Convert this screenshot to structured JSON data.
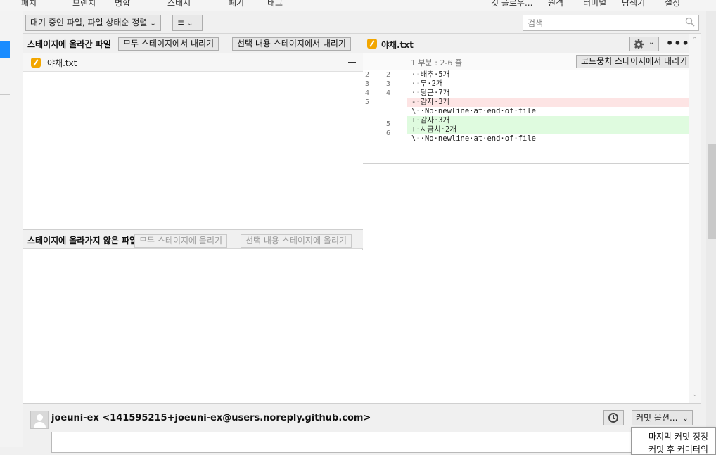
{
  "top_toolbar": {
    "labels": [
      "패치",
      "브랜치",
      "병합",
      "스태시",
      "폐기",
      "태그",
      "깃 플로우...",
      "원격",
      "터미널",
      "탐색기",
      "설정"
    ]
  },
  "filter_bar": {
    "sort_dropdown": "대기 중인 파일, 파일 상태순 정렬",
    "view_dropdown_icon": "list-icon",
    "search_placeholder": "검색"
  },
  "staged": {
    "title": "스테이지에 올라간 파일",
    "unstage_all_btn": "모두 스테이지에서 내리기",
    "unstage_selected_btn": "선택 내용 스테이지에서 내리기",
    "files": [
      {
        "name": "야채.txt",
        "status_icon": "modified-icon"
      }
    ]
  },
  "unstaged": {
    "title": "스테이지에 올라가지 않은 파일",
    "stage_all_btn": "모두 스테이지에 올리기",
    "stage_selected_btn": "선택 내용 스테이지에 올리기"
  },
  "diff": {
    "file_name": "야채.txt",
    "hunk_label": "1 부분 : 2-6 줄",
    "unstage_hunk_btn": "코드뭉치 스테이지에서 내리기",
    "lines": [
      {
        "old": "2",
        "new": "2",
        "type": "ctx",
        "text": "··배추·5개"
      },
      {
        "old": "3",
        "new": "3",
        "type": "ctx",
        "text": "··무·2개"
      },
      {
        "old": "4",
        "new": "4",
        "type": "ctx",
        "text": "··당근·7개"
      },
      {
        "old": "5",
        "new": "",
        "type": "del",
        "text": "-·감자·3개"
      },
      {
        "old": "",
        "new": "",
        "type": "ctx",
        "text": "\\··No·newline·at·end·of·file"
      },
      {
        "old": "",
        "new": "5",
        "type": "add",
        "text": "+·감자·3개"
      },
      {
        "old": "",
        "new": "6",
        "type": "add",
        "text": "+·시금치·2개"
      },
      {
        "old": "",
        "new": "",
        "type": "ctx",
        "text": "\\··No·newline·at·end·of·file"
      }
    ]
  },
  "commit": {
    "author": "joeuni-ex <141595215+joeuni-ex@users.noreply.github.com>",
    "options_btn": "커밋 옵션...",
    "menu_items": [
      "마지막 커밋 정정",
      "커밋 후 커미터의"
    ]
  },
  "colors": {
    "accent": "#1a8cff",
    "added_bg": "#dffbdf",
    "removed_bg": "#fde4e4",
    "modified_icon": "#f2a600"
  }
}
